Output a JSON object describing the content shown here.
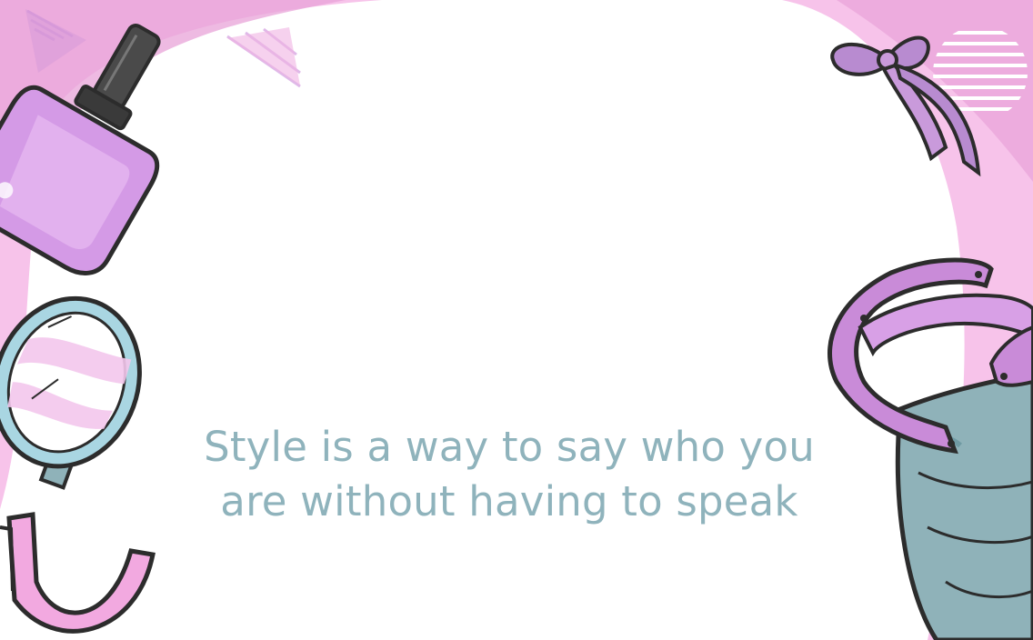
{
  "quote": {
    "line1": "Style is a way to say who you",
    "line2": "are without having to speak"
  },
  "colors": {
    "background_pink": "#f7c3ea",
    "deep_pink": "#e8a3d8",
    "quote_text": "#8fb3bc",
    "polish_purple": "#d49ae6",
    "mirror_blue": "#a9d6e2",
    "bag_teal": "#8fb2b9",
    "handle_mauve": "#c98bd8",
    "ribbon_purple": "#b88bd0",
    "outline": "#2c2c2c"
  },
  "icons": [
    "nail-polish-icon",
    "hand-mirror-icon",
    "ribbon-bow-icon",
    "handbag-icon",
    "headband-icon"
  ]
}
